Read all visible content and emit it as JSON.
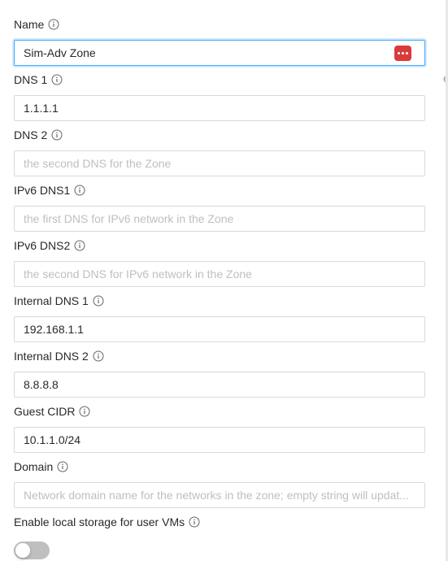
{
  "form": {
    "name": {
      "label": "Name",
      "value": "Sim-Adv Zone"
    },
    "dns1": {
      "label": "DNS 1",
      "value": "1.1.1.1"
    },
    "dns2": {
      "label": "DNS 2",
      "placeholder": "the second DNS for the Zone"
    },
    "ipv6dns1": {
      "label": "IPv6 DNS1",
      "placeholder": "the first DNS for IPv6 network in the Zone"
    },
    "ipv6dns2": {
      "label": "IPv6 DNS2",
      "placeholder": "the second DNS for IPv6 network in the Zone"
    },
    "internaldns1": {
      "label": "Internal DNS 1",
      "value": "192.168.1.1"
    },
    "internaldns2": {
      "label": "Internal DNS 2",
      "value": "8.8.8.8"
    },
    "guestcidr": {
      "label": "Guest CIDR",
      "value": "10.1.1.0/24"
    },
    "domain": {
      "label": "Domain",
      "placeholder": "Network domain name for the networks in the zone; empty string will updat..."
    },
    "localstorage": {
      "label": "Enable local storage for user VMs",
      "enabled": false
    }
  },
  "edge_text": "e",
  "colors": {
    "focus_border": "#40a9ff",
    "input_border": "#d9d9d9",
    "placeholder": "#bfbfbf",
    "toggle_off": "#bfbfbf",
    "password_manager": "#d93b3b"
  },
  "icons": {
    "info": "info-circle-icon",
    "password_manager": "password-manager-icon"
  }
}
